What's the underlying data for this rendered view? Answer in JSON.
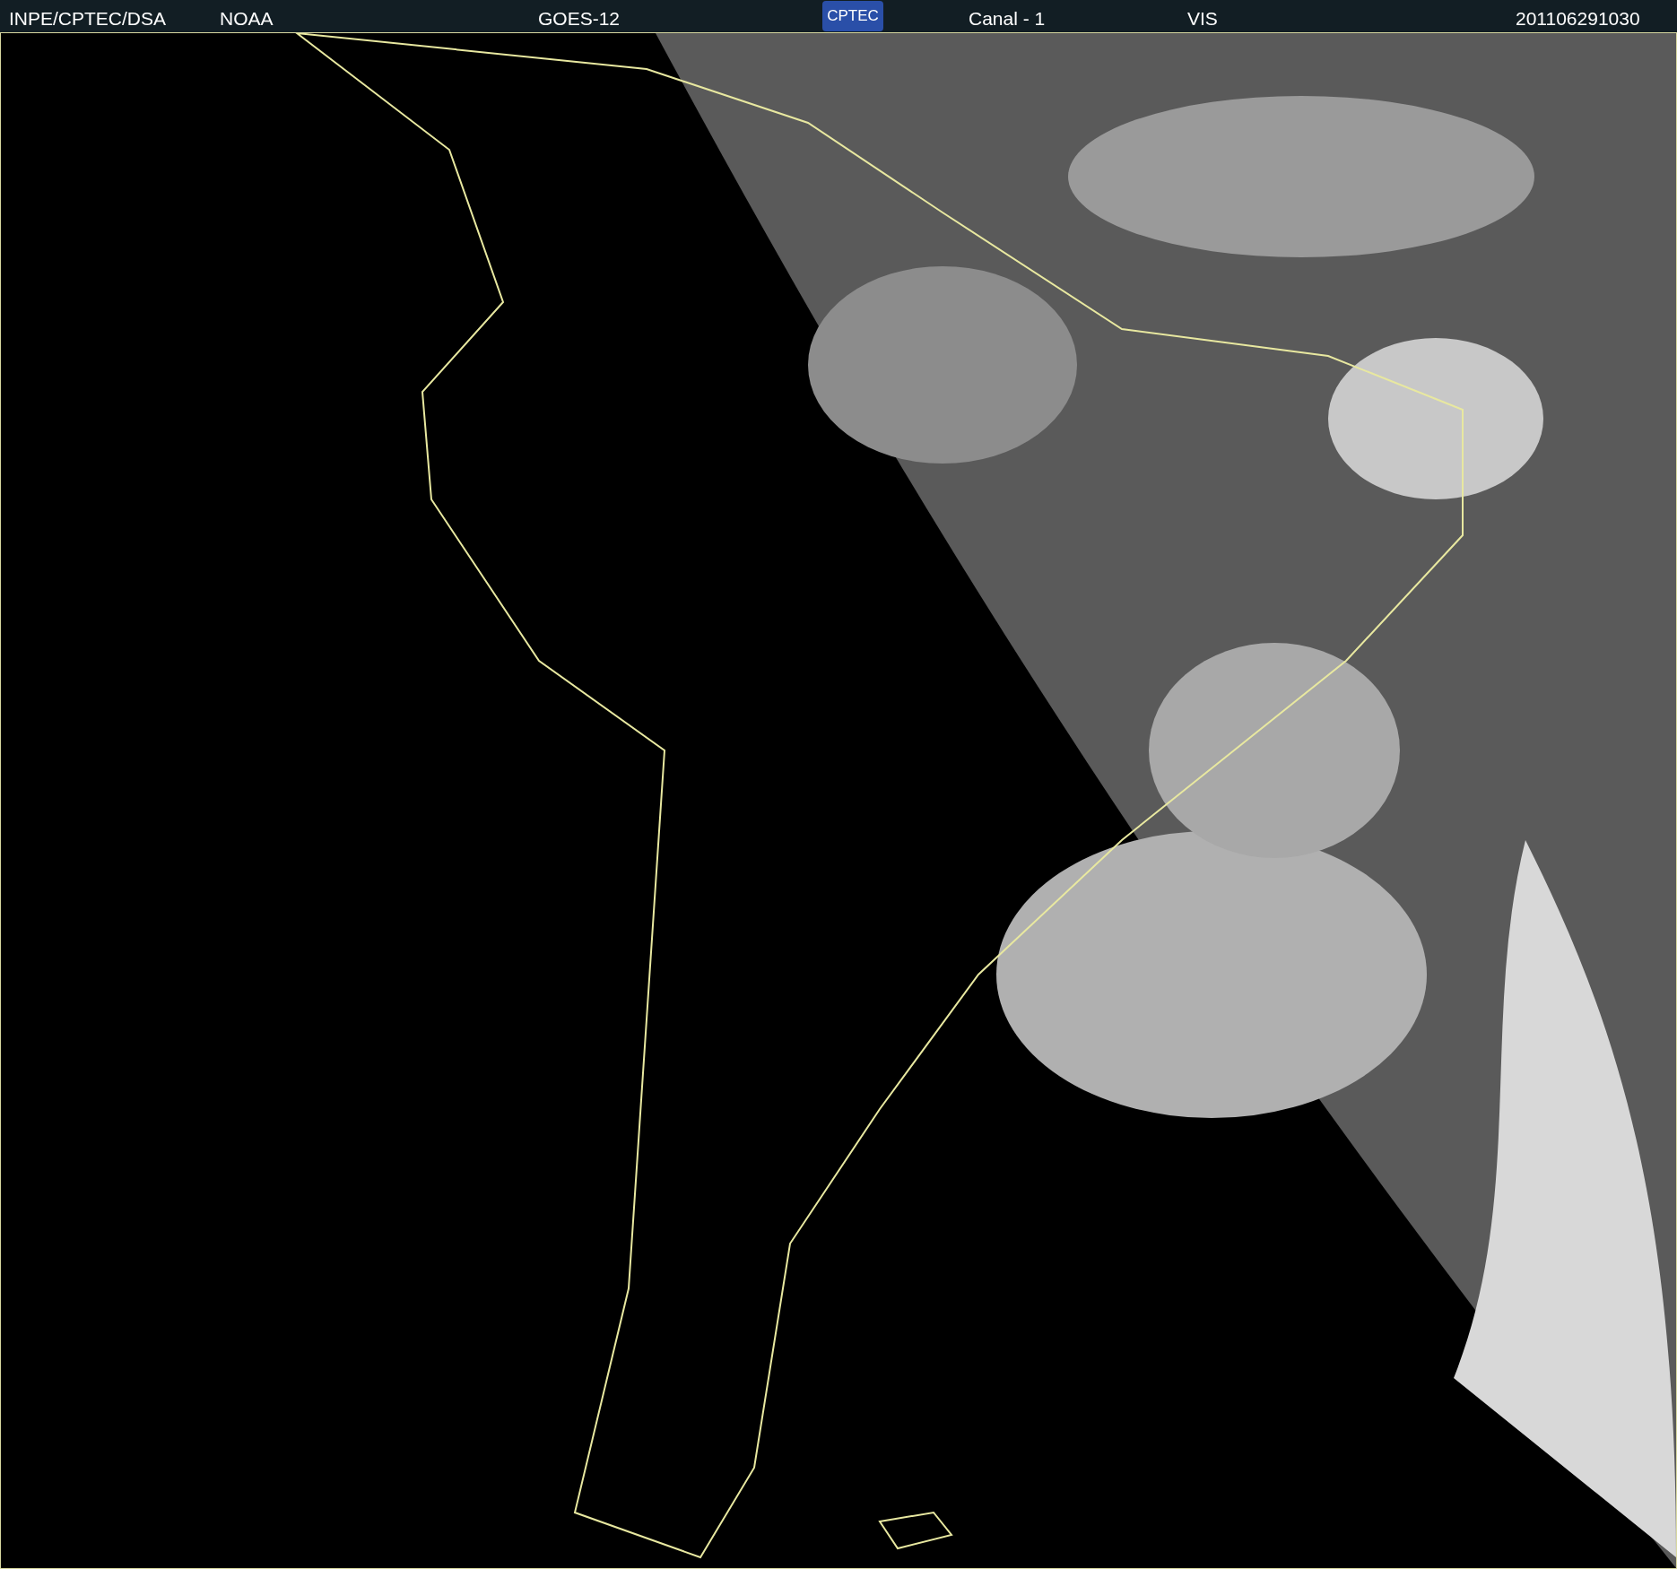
{
  "header": {
    "items": [
      {
        "kind": "text",
        "text": "INPE/CPTEC/DSA"
      },
      {
        "kind": "text",
        "text": "NOAA"
      },
      {
        "kind": "text",
        "text": "GOES-12"
      },
      {
        "kind": "logo",
        "text": "CPTEC"
      },
      {
        "kind": "text",
        "text": "Canal - 1"
      },
      {
        "kind": "text",
        "text": "VIS"
      },
      {
        "kind": "text",
        "text": "201106291030"
      }
    ]
  }
}
